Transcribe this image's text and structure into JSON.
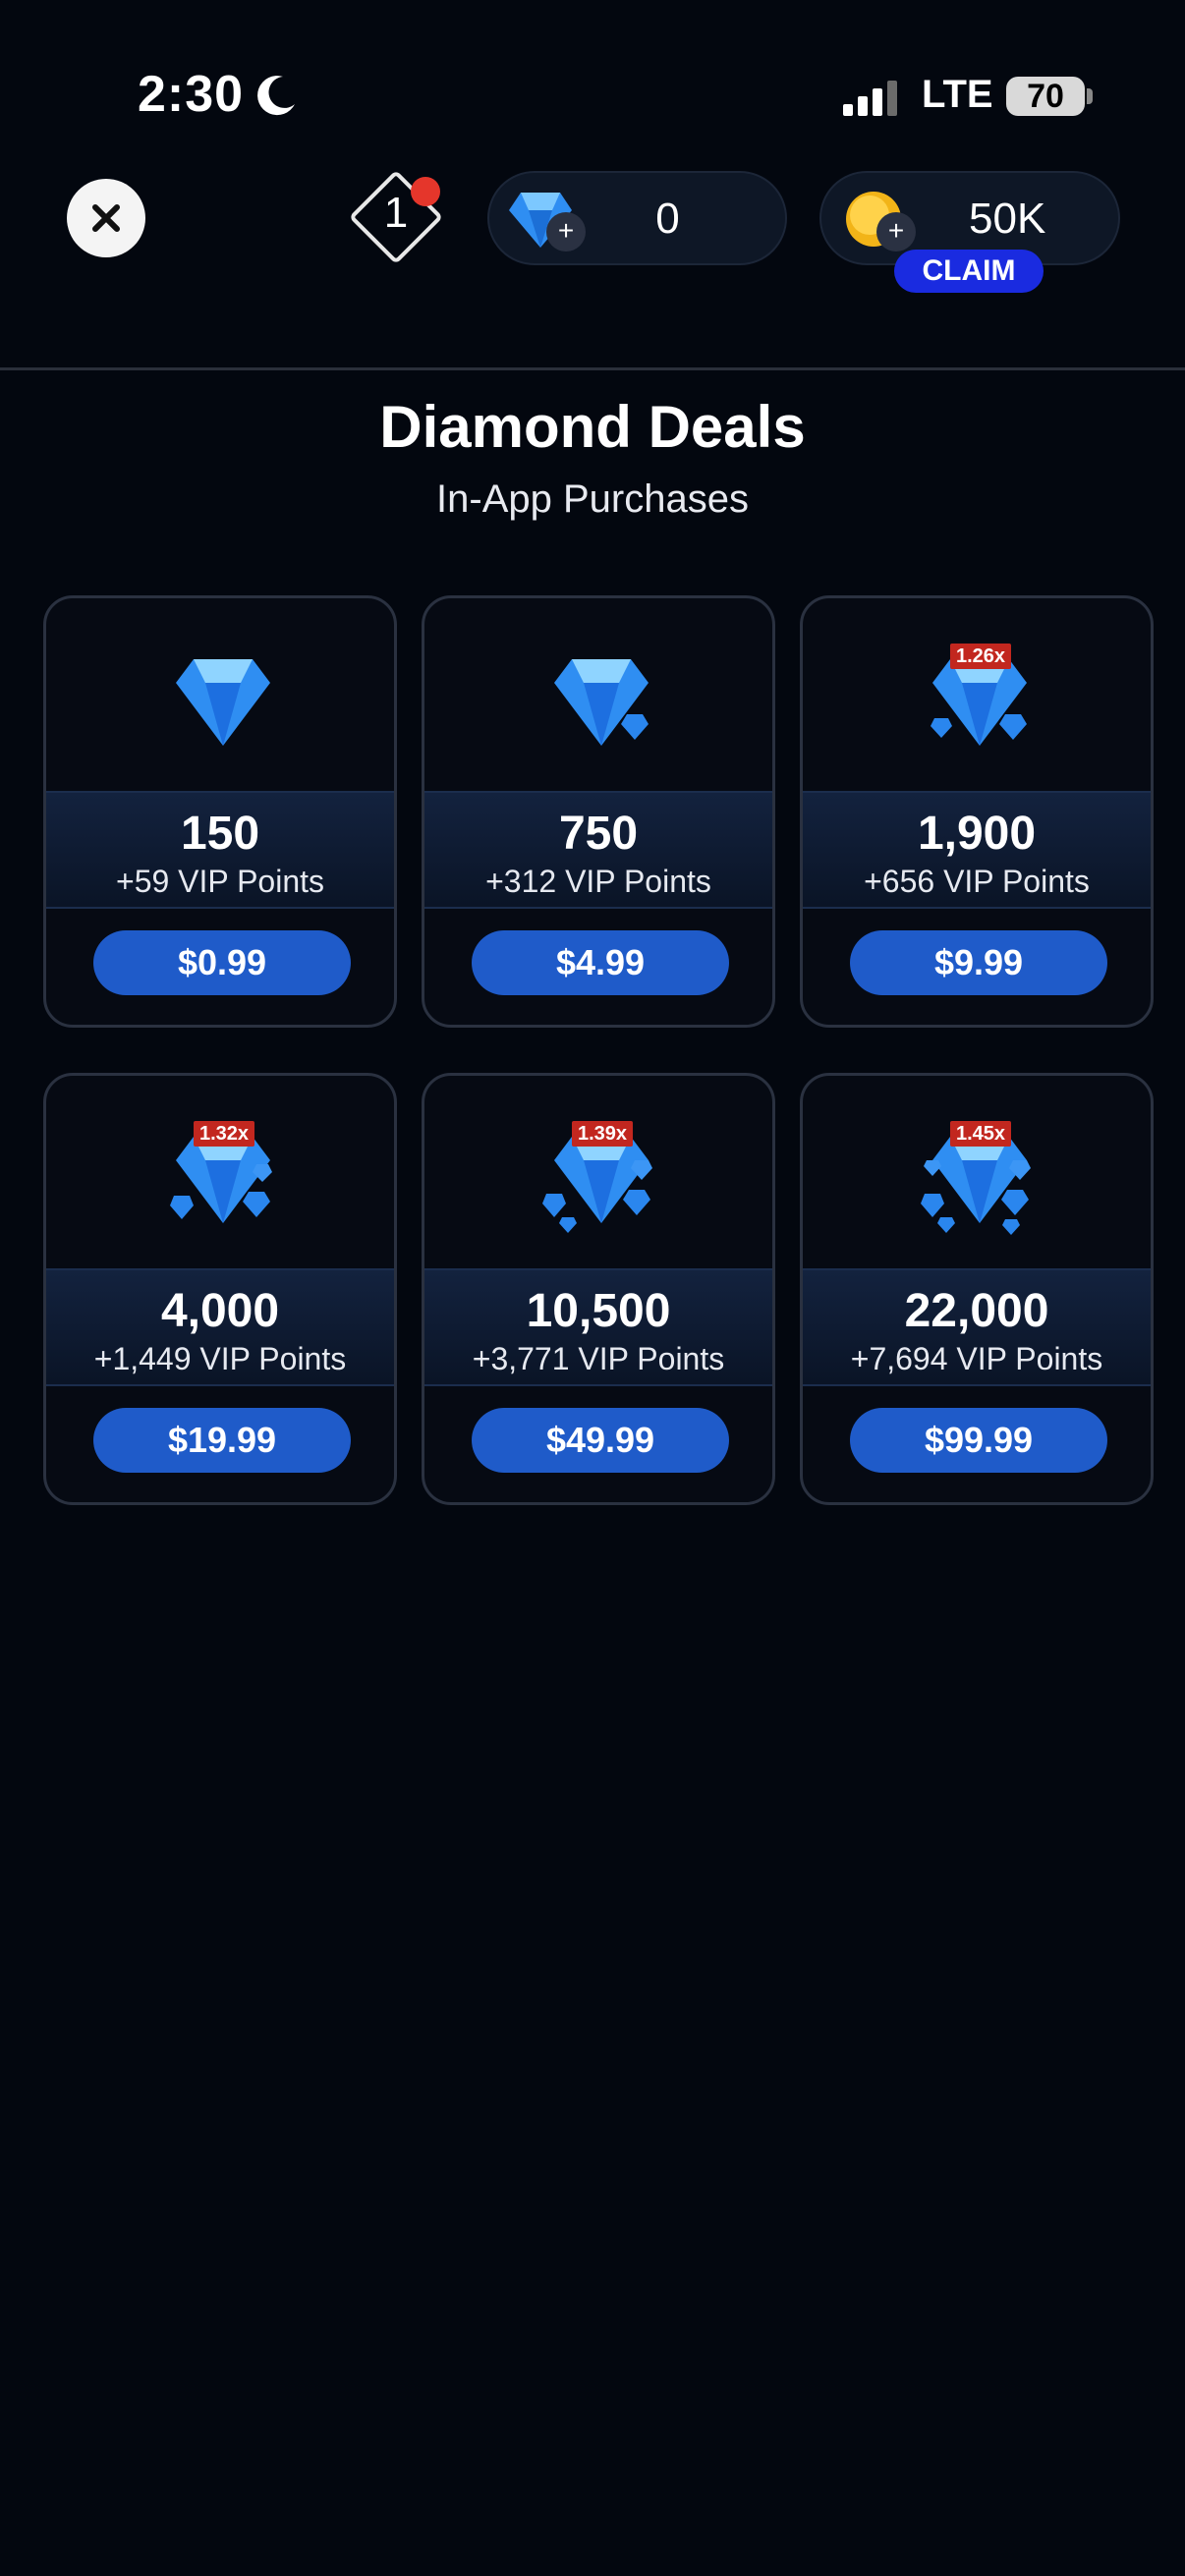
{
  "status_bar": {
    "time": "2:30",
    "network": "LTE",
    "battery": "70"
  },
  "top_bar": {
    "level": "1",
    "diamonds": "0",
    "coins": "50K",
    "claim_label": "CLAIM",
    "plus_symbol": "+",
    "close_symbol": "✕"
  },
  "header": {
    "title": "Diamond Deals",
    "subtitle": "In-App Purchases"
  },
  "deals": [
    {
      "amount": "150",
      "vip": "+59 VIP Points",
      "price": "$0.99",
      "bonus": ""
    },
    {
      "amount": "750",
      "vip": "+312 VIP Points",
      "price": "$4.99",
      "bonus": ""
    },
    {
      "amount": "1,900",
      "vip": "+656 VIP Points",
      "price": "$9.99",
      "bonus": "1.26x"
    },
    {
      "amount": "4,000",
      "vip": "+1,449 VIP Points",
      "price": "$19.99",
      "bonus": "1.32x"
    },
    {
      "amount": "10,500",
      "vip": "+3,771 VIP Points",
      "price": "$49.99",
      "bonus": "1.39x"
    },
    {
      "amount": "22,000",
      "vip": "+7,694 VIP Points",
      "price": "$99.99",
      "bonus": "1.45x"
    }
  ],
  "colors": {
    "background": "#03070f",
    "price_button": "#1f5bc9",
    "claim_button": "#1a2be0",
    "bonus_tag": "#c2271f",
    "notification_dot": "#e5362b"
  },
  "icons": [
    "moon-icon",
    "signal-icon",
    "close-icon",
    "level-diamond-icon",
    "diamond-icon",
    "coin-icon",
    "gem-icon"
  ]
}
